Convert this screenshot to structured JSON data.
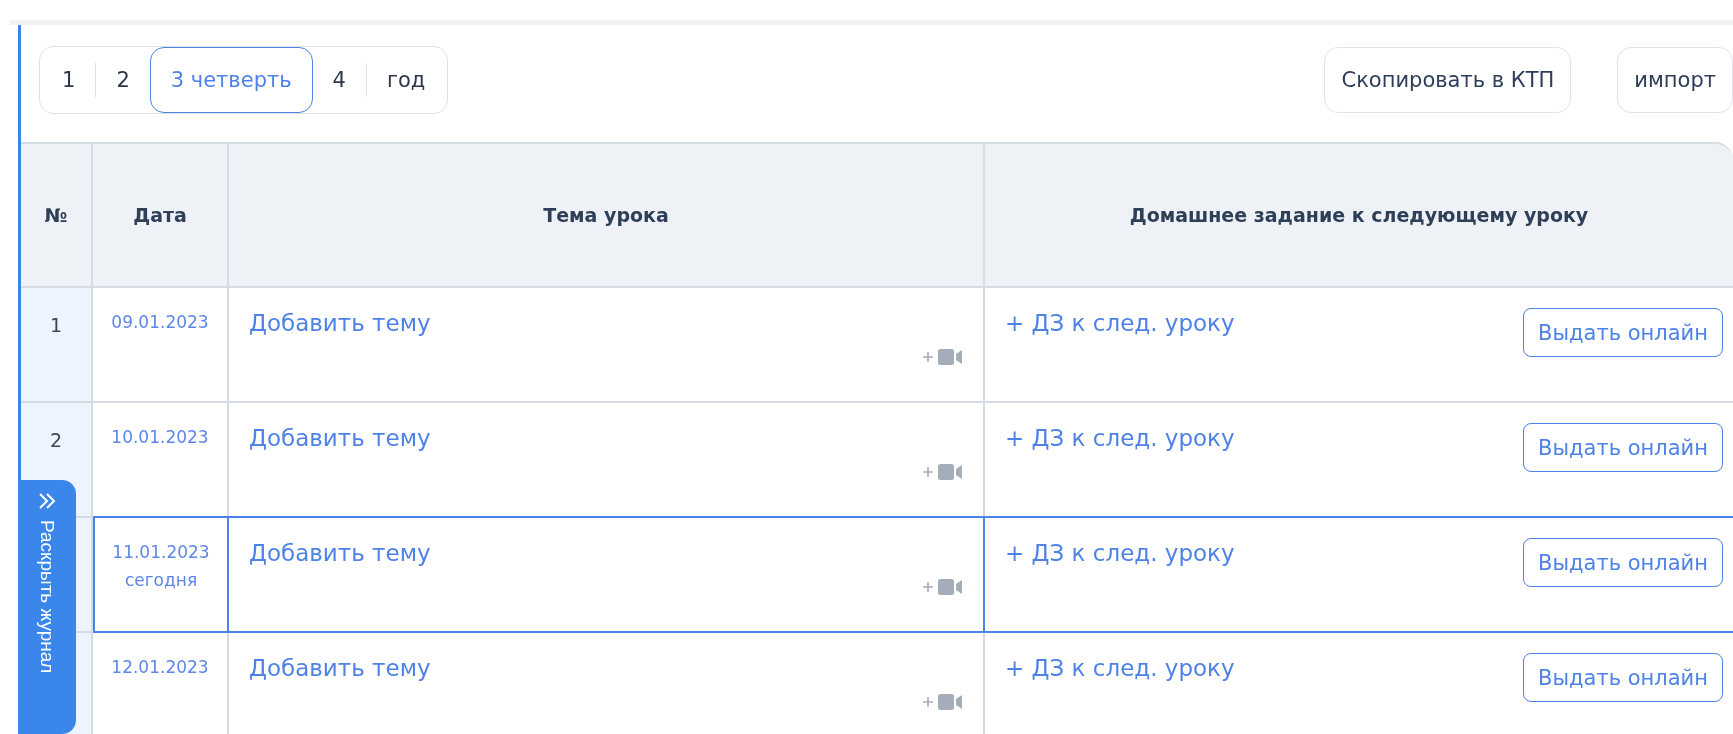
{
  "periods": [
    {
      "label": "1",
      "selected": false
    },
    {
      "label": "2",
      "selected": false
    },
    {
      "label": "3 четверть",
      "selected": true
    },
    {
      "label": "4",
      "selected": false
    },
    {
      "label": "год",
      "selected": false
    }
  ],
  "actions": [
    "Скопировать в КТП",
    "импорт"
  ],
  "table": {
    "columns": [
      "№",
      "Дата",
      "Тема урока",
      "Домашнее задание к следующему уроку"
    ],
    "rows": [
      {
        "number": "1",
        "date": "09.01.2023",
        "today": false,
        "topic": "Добавить тему",
        "homework": "+ ДЗ к след. уроку",
        "online": "Выдать онлайн"
      },
      {
        "number": "2",
        "date": "10.01.2023",
        "today": false,
        "topic": "Добавить тему",
        "homework": "+ ДЗ к след. уроку",
        "online": "Выдать онлайн"
      },
      {
        "date": "11.01.2023",
        "today": true,
        "today_label": "сегодня",
        "topic": "Добавить тему",
        "homework": "+ ДЗ к след. уроку",
        "online": "Выдать онлайн"
      },
      {
        "date": "12.01.2023",
        "today": false,
        "topic": "Добавить тему",
        "homework": "+ ДЗ к след. уроку",
        "online": "Выдать онлайн"
      }
    ]
  },
  "side_tab": {
    "label": "Раскрыть журнал"
  }
}
